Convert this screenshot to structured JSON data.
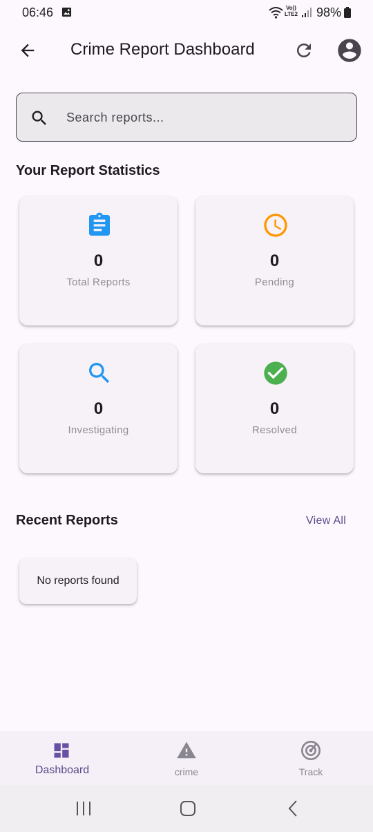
{
  "status_bar": {
    "time": "06:46",
    "volte_top": "Vo))",
    "volte_bottom": "LTE2",
    "battery_percent": "98%"
  },
  "app_bar": {
    "title": "Crime Report Dashboard"
  },
  "search": {
    "placeholder": "Search reports..."
  },
  "statistics": {
    "title": "Your Report Statistics",
    "cards": [
      {
        "value": "0",
        "label": "Total Reports",
        "icon": "clipboard-icon",
        "color": "#2196f3"
      },
      {
        "value": "0",
        "label": "Pending",
        "icon": "clock-icon",
        "color": "#ff9800"
      },
      {
        "value": "0",
        "label": "Investigating",
        "icon": "search-icon",
        "color": "#2196f3"
      },
      {
        "value": "0",
        "label": "Resolved",
        "icon": "check-circle-icon",
        "color": "#4caf50"
      }
    ]
  },
  "recent": {
    "title": "Recent Reports",
    "view_all": "View All",
    "empty_message": "No reports found"
  },
  "bottom_nav": {
    "items": [
      {
        "label": "Dashboard",
        "icon": "dashboard-icon",
        "active": true
      },
      {
        "label": "crime",
        "icon": "warning-icon",
        "active": false
      },
      {
        "label": "Track",
        "icon": "track-icon",
        "active": false
      }
    ]
  },
  "colors": {
    "accent": "#6750a4",
    "background": "#fdf7fe",
    "inactive": "#8a8690"
  }
}
